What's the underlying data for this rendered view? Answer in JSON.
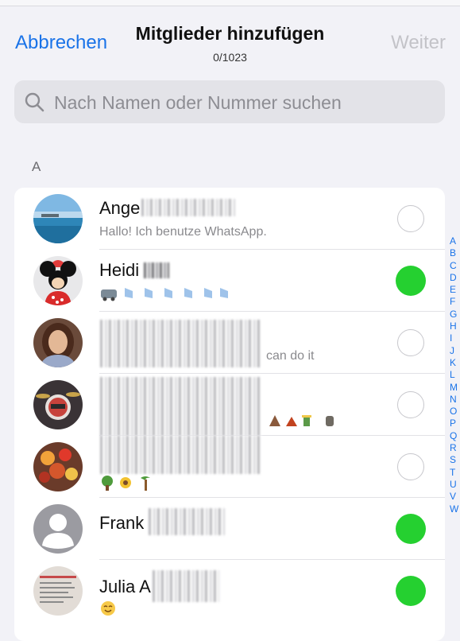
{
  "nav": {
    "cancel_label": "Abbrechen",
    "title": "Mitglieder hinzufügen",
    "count": "0/1023",
    "next_label": "Weiter"
  },
  "search": {
    "placeholder": "Nach Namen oder Nummer suchen"
  },
  "section_header": "A",
  "contacts": [
    {
      "name": "Ange",
      "status": "Hallo! Ich benutze WhatsApp.",
      "selected": false
    },
    {
      "name": "Heidi",
      "status": "",
      "selected": true
    },
    {
      "name": "",
      "status": "can do it",
      "selected": false
    },
    {
      "name": "",
      "status": "",
      "selected": false
    },
    {
      "name": "",
      "status": "",
      "selected": false
    },
    {
      "name": "Frank",
      "status": "",
      "selected": true
    },
    {
      "name": "Julia A",
      "status": "",
      "selected": true
    }
  ],
  "index_letters": [
    "A",
    "B",
    "C",
    "D",
    "E",
    "F",
    "G",
    "H",
    "I",
    "J",
    "K",
    "L",
    "M",
    "N",
    "O",
    "P",
    "Q",
    "R",
    "S",
    "T",
    "U",
    "V",
    "W"
  ],
  "colors": {
    "accent": "#1a73e8",
    "selected": "#25d030",
    "background": "#f2f2f7"
  }
}
